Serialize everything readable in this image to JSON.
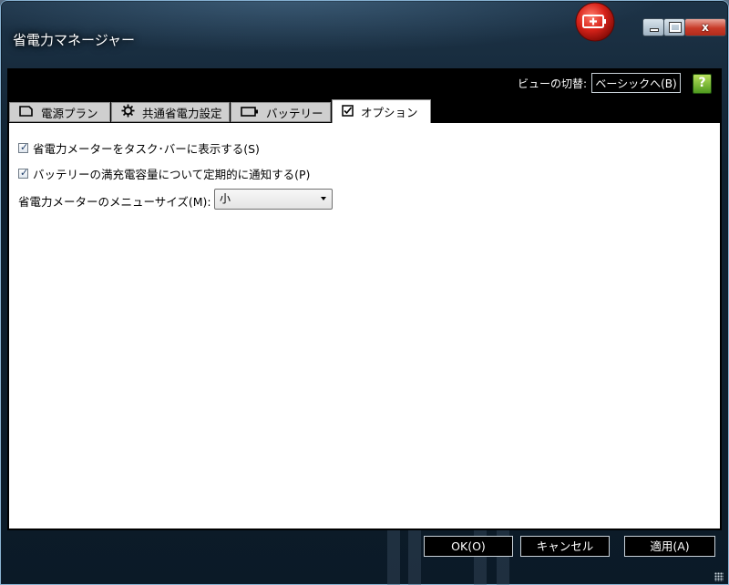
{
  "window": {
    "title": "省電力マネージャー",
    "close_label": "x",
    "colors": {
      "titlebar": "#0f2130",
      "content": "#ffffff",
      "tabs": "#cfcfcf",
      "accent": "#c8281a"
    }
  },
  "toolbar": {
    "view_switch_label": "ビューの切替:",
    "basic_button": "ベーシックへ(B)",
    "help_icon": "?"
  },
  "tabs": [
    {
      "label": "電源プラン",
      "icon": "battery-outline-icon",
      "active": false
    },
    {
      "label": "共通省電力設定",
      "icon": "gear-icon",
      "active": false
    },
    {
      "label": "バッテリー",
      "icon": "battery-icon",
      "active": false
    },
    {
      "label": "オプション",
      "icon": "checkbox-icon",
      "active": true
    }
  ],
  "options": {
    "show_meter_taskbar": {
      "label": "省電力メーターをタスク･バーに表示する(S)",
      "checked": true
    },
    "notify_full_capacity": {
      "label": "バッテリーの満充電容量について定期的に通知する(P)",
      "checked": true
    },
    "menu_size": {
      "label": "省電力メーターのメニューサイズ(M):",
      "value": "小"
    }
  },
  "footer": {
    "ok": "OK(O)",
    "cancel": "キャンセル",
    "apply": "適用(A)"
  }
}
